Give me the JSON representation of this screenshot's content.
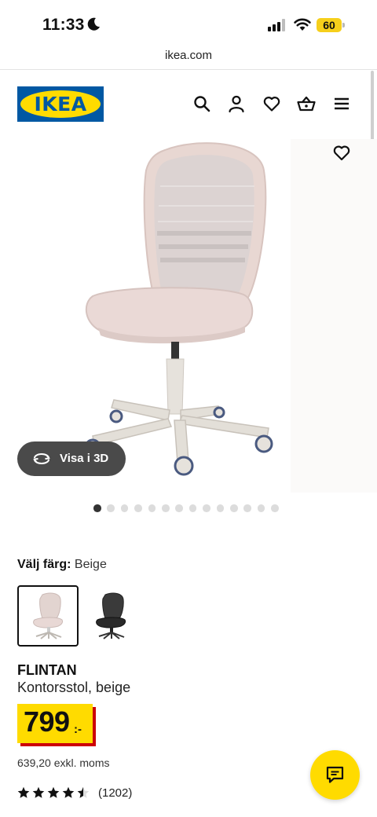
{
  "status_bar": {
    "time": "11:33",
    "battery_level": "60"
  },
  "browser": {
    "url": "ikea.com"
  },
  "header": {
    "logo_text": "IKEA",
    "icons": [
      "search-icon",
      "account-icon",
      "favourites-icon",
      "cart-icon",
      "menu-icon"
    ]
  },
  "gallery": {
    "view_3d_label": "Visa i 3D",
    "image_count": 14,
    "active_index": 0
  },
  "color_picker": {
    "label": "Välj färg:",
    "selected": "Beige",
    "options": [
      "Beige",
      "Svart"
    ]
  },
  "product": {
    "name": "FLINTAN",
    "description": "Kontorsstol, beige",
    "price": "799",
    "price_suffix": ":-",
    "price_excl_vat": "639,20 exkl. moms",
    "rating": 4.5,
    "review_count": "(1202)"
  },
  "colors": {
    "ikea_blue": "#0058a3",
    "ikea_yellow": "#ffdb00",
    "price_shadow": "#cc0008"
  }
}
